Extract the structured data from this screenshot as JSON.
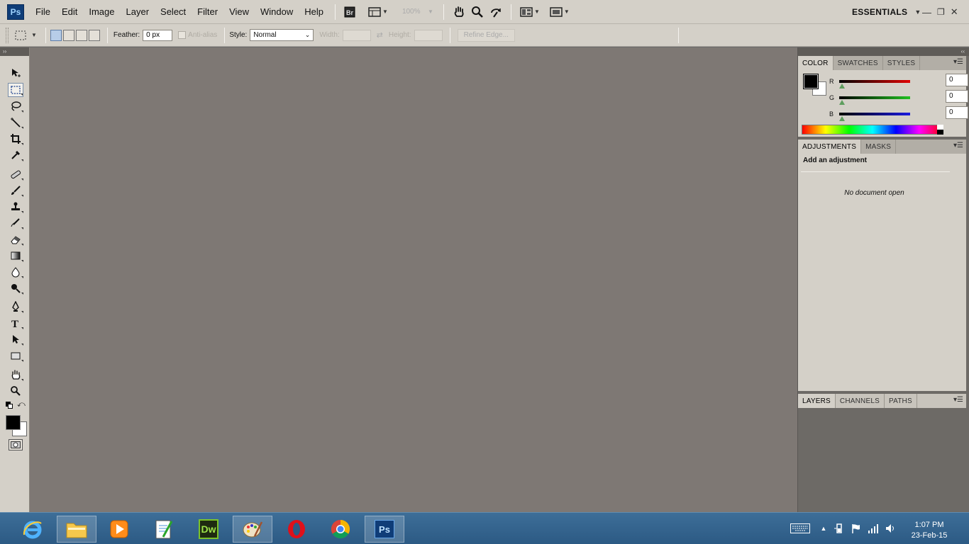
{
  "app": {
    "logo": "Ps"
  },
  "menu": [
    "File",
    "Edit",
    "Image",
    "Layer",
    "Select",
    "Filter",
    "View",
    "Window",
    "Help"
  ],
  "app_bar": {
    "zoom_value": "100%",
    "workspace": "ESSENTIALS"
  },
  "options": {
    "feather_label": "Feather:",
    "feather_value": "0 px",
    "antialias_label": "Anti-alias",
    "style_label": "Style:",
    "style_value": "Normal",
    "width_label": "Width:",
    "height_label": "Height:",
    "refine_label": "Refine Edge..."
  },
  "color_panel": {
    "tabs": [
      "COLOR",
      "SWATCHES",
      "STYLES"
    ],
    "active_tab": "COLOR",
    "r_label": "R",
    "g_label": "G",
    "b_label": "B",
    "r_value": "0",
    "g_value": "0",
    "b_value": "0",
    "foreground": "#000000",
    "background": "#ffffff"
  },
  "adjustments_panel": {
    "tabs": [
      "ADJUSTMENTS",
      "MASKS"
    ],
    "heading": "Add an adjustment",
    "status": "No document open"
  },
  "layers_panel": {
    "tabs": [
      "LAYERS",
      "CHANNELS",
      "PATHS"
    ]
  },
  "tools": [
    "move-tool",
    "rectangular-marquee-tool",
    "lasso-tool",
    "quick-selection-tool",
    "crop-tool",
    "eyedropper-tool",
    "healing-brush-tool",
    "brush-tool",
    "clone-stamp-tool",
    "history-brush-tool",
    "eraser-tool",
    "gradient-tool",
    "blur-tool",
    "dodge-tool",
    "pen-tool",
    "type-tool",
    "path-selection-tool",
    "rectangle-tool",
    "hand-tool",
    "zoom-tool"
  ],
  "taskbar": {
    "apps": [
      "internet-explorer",
      "file-explorer",
      "media-player",
      "notepad",
      "dreamweaver",
      "paint",
      "opera",
      "chrome",
      "photoshop"
    ],
    "dw_label": "Dw",
    "ps_label": "Ps",
    "time": "1:07 PM",
    "date": "23-Feb-15"
  }
}
